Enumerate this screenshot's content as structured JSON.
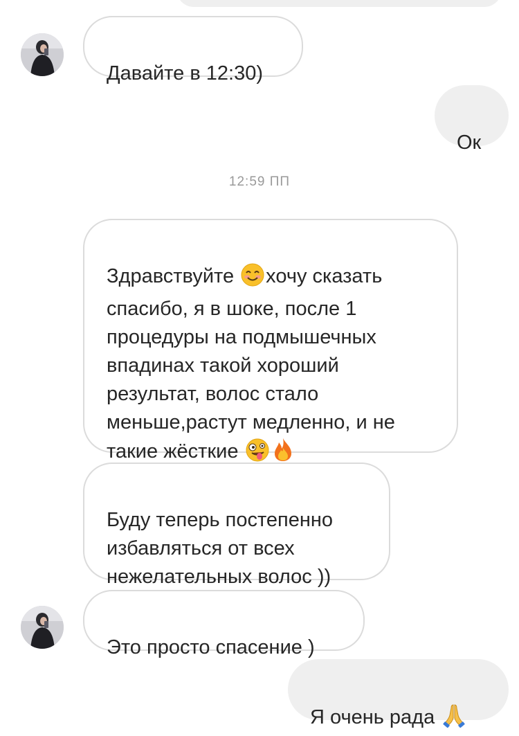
{
  "conversation": {
    "timestamp": "12:59 ПП",
    "messages": {
      "m1": "Давайте в 12:30)",
      "m2": "Ок",
      "m3_part1": "Здравствуйте ",
      "m3_part2": "хочу сказать спасибо, я в шоке, после 1 процедуры на подмышечных впадинах такой хороший результат, волос стало меньше,растут медленно, и не такие жёсткие ",
      "m4": "Буду теперь постепенно избавляться от всех нежелательных волос ))",
      "m5": "Это просто спасение )",
      "m6": "Я очень рада "
    }
  },
  "icons": {
    "avatar": "user-avatar-photo",
    "smile": "smiling-face-emoji",
    "zany": "zany-face-emoji",
    "fire": "fire-emoji",
    "pray": "folded-hands-emoji"
  },
  "colors": {
    "incoming_border": "#dbdbdb",
    "outgoing_bg": "#efefef",
    "timestamp": "#999999",
    "text": "#262626"
  }
}
